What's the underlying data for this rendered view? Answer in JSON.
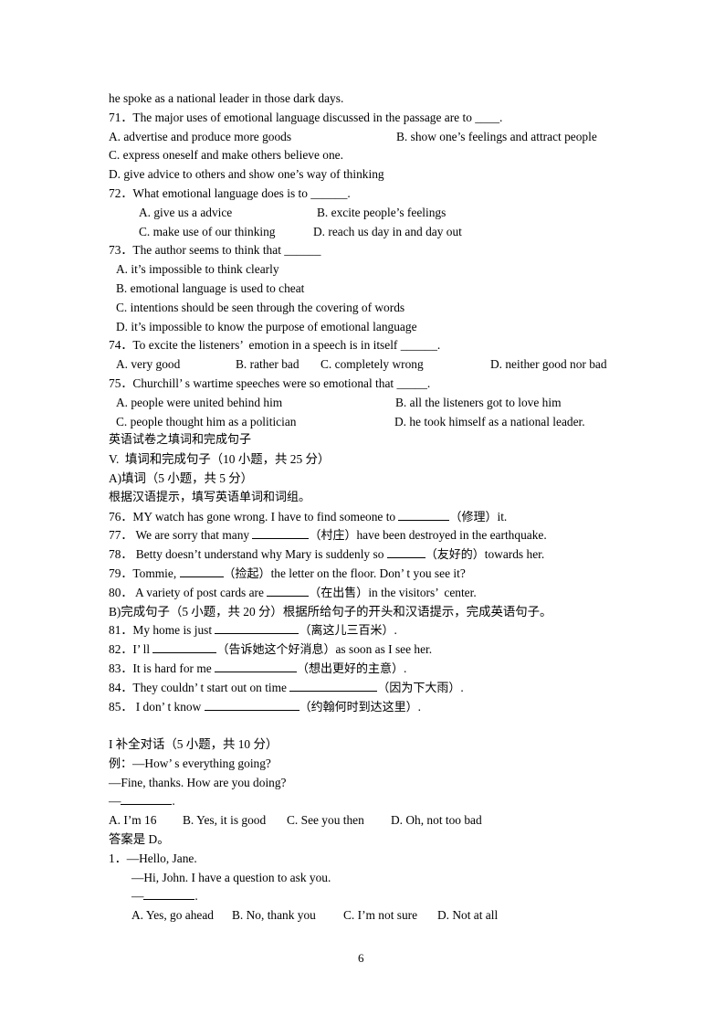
{
  "intro_line": "he spoke as a national leader in those dark days.",
  "reading_questions": [
    {
      "number": "71",
      "stem": "The major uses of emotional language discussed in the passage are to ____.",
      "options": {
        "A": "A. advertise and produce more goods",
        "B": "B. show one’s feelings and attract people",
        "C": "C. express oneself and make others believe one.",
        "D": "D. give advice to others and show one’s way of thinking"
      }
    },
    {
      "number": "72",
      "stem": "What emotional language does is to ______.",
      "options": {
        "A": "A. give us a advice",
        "B": "B. excite people’s feelings",
        "C": "C. make use of our thinking",
        "D": "D. reach us day in and day out"
      }
    },
    {
      "number": "73",
      "stem": "The author seems to think that ______",
      "options": {
        "A": "A. it’s impossible to think clearly",
        "B": "B. emotional language is used to cheat",
        "C": "C. intentions should be seen through the covering of words",
        "D": "D. it’s impossible to know the purpose of emotional language"
      }
    },
    {
      "number": "74",
      "stem": "To excite the listeners’  emotion in a speech is in itself ______.",
      "options": {
        "A": "A. very good",
        "B": "B. rather bad",
        "C": "C. completely wrong",
        "D": "D. neither good nor bad"
      }
    },
    {
      "number": "75",
      "stem": "Churchill’ s wartime speeches were so emotional that _____.",
      "options": {
        "A": "A. people were united behind him",
        "B": "B. all the listeners got to love him",
        "C": "C. people thought him as a politician",
        "D": "D. he took himself as a national leader."
      }
    }
  ],
  "section_v": {
    "doc_title": "英语试卷之填词和完成句子",
    "heading": "V.  填词和完成句子（10 小题，共 25 分）",
    "part_a_heading": "A)填词（5 小题，共 5 分）",
    "part_a_instruction": "根据汉语提示，填写英语单词和词组。",
    "fill_words": [
      {
        "number": "76",
        "before": "MY watch has gone wrong. I have to find someone to ",
        "hint": "（修理）",
        "after": "it."
      },
      {
        "number": "77",
        "before": " We are sorry that many ",
        "hint": "（村庄）",
        "after": "have been destroyed in the earthquake."
      },
      {
        "number": "78",
        "before": " Betty doesn’t understand why Mary is suddenly so ",
        "hint": "（友好的）",
        "after": "towards her."
      },
      {
        "number": "79",
        "before": "Tommie, ",
        "hint": "（捡起）",
        "after": "the letter on the floor. Don’ t you see it?"
      },
      {
        "number": "80",
        "before": " A variety of post cards are ",
        "hint": "（在出售）",
        "after": "in the visitors’  center."
      }
    ],
    "part_b_heading": "B)完成句子（5 小题，共 20 分）根据所给句子的开头和汉语提示，完成英语句子。",
    "complete_sentences": [
      {
        "number": "81",
        "before": "My home is just ",
        "hint": "（离这儿三百米）",
        "after": "."
      },
      {
        "number": "82",
        "before": "I’ ll ",
        "hint": "（告诉她这个好消息）",
        "after": "as soon as I see her."
      },
      {
        "number": "83",
        "before": "It is hard for me ",
        "hint": "（想出更好的主意）",
        "after": "."
      },
      {
        "number": "84",
        "before": "They couldn’ t start out on time ",
        "hint": "（因为下大雨）",
        "after": "."
      },
      {
        "number": "85",
        "before": " I don’ t know ",
        "hint": "（约翰何时到达这里）",
        "after": "."
      }
    ]
  },
  "section_dialogue": {
    "heading": "I 补全对话（5 小题，共 10 分）",
    "example_label": "例：",
    "example_lines": [
      "—How’ s everything going?",
      "—Fine, thanks. How are you doing?",
      "—"
    ],
    "example_options": {
      "A": "A. I’m 16",
      "B": "B. Yes, it is good",
      "C": "C. See you then",
      "D": "D. Oh, not too bad"
    },
    "example_answer": "答案是 D。",
    "questions": [
      {
        "number": "1",
        "lines": [
          "—Hello, Jane.",
          "—Hi, John. I have a question to ask you.",
          "—"
        ],
        "options": {
          "A": "A. Yes, go ahead",
          "B": "B. No, thank you",
          "C": "C. I’m not sure",
          "D": "D. Not at all"
        }
      }
    ]
  },
  "page_number": "6"
}
